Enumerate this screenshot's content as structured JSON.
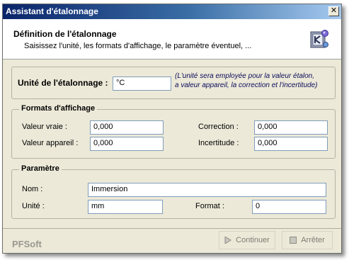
{
  "window": {
    "title": "Assistant d'étalonnage",
    "close_glyph": "✕"
  },
  "header": {
    "title": "Définition de l'étalonnage",
    "subtitle": "Saisissez l'unité, les formats d'affichage, le paramètre éventuel, ...",
    "icon": "wizard-icon"
  },
  "unit": {
    "label": "Unité de l'étalonnage :",
    "value": "°C",
    "note_line1": "(L'unité sera employée pour la valeur étalon,",
    "note_line2": "a valeur appareil, la correction et l'incertitude)"
  },
  "formats": {
    "legend": "Formats d'affichage",
    "valeur_vraie_label": "Valeur vraie :",
    "valeur_vraie_value": "0,000",
    "valeur_appareil_label": "Valeur appareil :",
    "valeur_appareil_value": "0,000",
    "correction_label": "Correction :",
    "correction_value": "0,000",
    "incertitude_label": "Incertitude :",
    "incertitude_value": "0,000"
  },
  "parametre": {
    "legend": "Paramètre",
    "nom_label": "Nom :",
    "nom_value": "Immersion",
    "unite_label": "Unité :",
    "unite_value": "mm",
    "format_label": "Format :",
    "format_value": "0"
  },
  "footer": {
    "brand": "PFSoft",
    "continue_label": "Continuer",
    "stop_label": "Arrêter"
  },
  "colors": {
    "title_start": "#0a246a",
    "title_end": "#a6caf0",
    "dialog_bg": "#ece9d8",
    "field_border": "#7f9db9"
  }
}
